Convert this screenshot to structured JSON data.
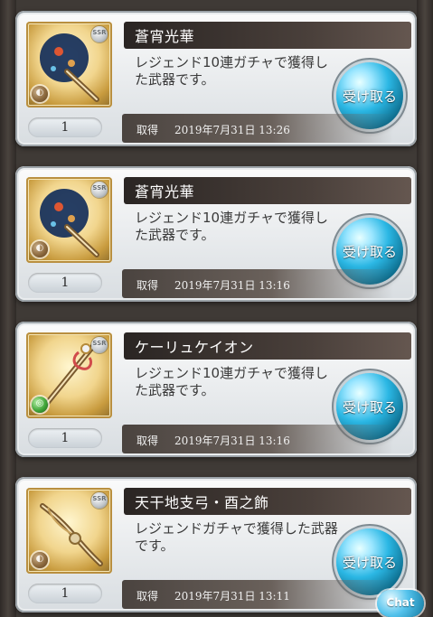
{
  "items": [
    {
      "name": "蒼宵光華",
      "description": "レジェンド10連ガチャで獲得した武器です。",
      "rarity_badge": "SSR",
      "element_icon": "dark-element-icon",
      "quantity": "1",
      "acquired_label": "取得",
      "acquired_datetime": "2019年7月31日 13:26",
      "receive_label": "受け取る"
    },
    {
      "name": "蒼宵光華",
      "description": "レジェンド10連ガチャで獲得した武器です。",
      "rarity_badge": "SSR",
      "element_icon": "dark-element-icon",
      "quantity": "1",
      "acquired_label": "取得",
      "acquired_datetime": "2019年7月31日 13:16",
      "receive_label": "受け取る"
    },
    {
      "name": "ケーリュケイオン",
      "description": "レジェンド10連ガチャで獲得した武器です。",
      "rarity_badge": "SSR",
      "element_icon": "wind-element-icon",
      "quantity": "1",
      "acquired_label": "取得",
      "acquired_datetime": "2019年7月31日 13:16",
      "receive_label": "受け取る"
    },
    {
      "name": "天干地支弓・酉之飾",
      "description": "レジェンドガチャで獲得した武器です。",
      "rarity_badge": "SSR",
      "element_icon": "dark-element-icon",
      "quantity": "1",
      "acquired_label": "取得",
      "acquired_datetime": "2019年7月31日 13:11",
      "receive_label": "受け取る"
    }
  ],
  "chat": {
    "label": "Chat"
  },
  "colors": {
    "background": "#3f3a36",
    "card_bg": "#f3f5f6",
    "title_bar": "#3b3431",
    "button_blue": "#2bb7e4"
  }
}
